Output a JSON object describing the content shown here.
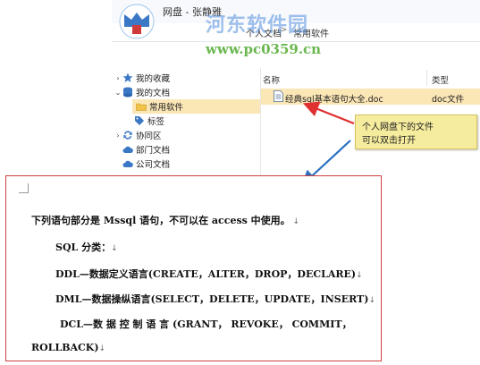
{
  "window": {
    "title": "网盘 - 张静雅",
    "address": {
      "part1": "个人文档",
      "separator": ">",
      "part2": "常用软件"
    }
  },
  "watermark": {
    "site_name": "河东软件园",
    "url": "www.pc0359.cn"
  },
  "nav": {
    "items": [
      {
        "label": "我的收藏",
        "icon": "star-icon",
        "expanded": false
      },
      {
        "label": "我的文档",
        "icon": "database-icon",
        "expanded": true
      },
      {
        "label": "常用软件",
        "icon": "folder-icon",
        "selected": true
      },
      {
        "label": "标签",
        "icon": "tag-icon"
      },
      {
        "label": "协同区",
        "icon": "sync-icon",
        "expanded": false
      },
      {
        "label": "部门文档",
        "icon": "cloud-icon"
      },
      {
        "label": "公司文档",
        "icon": "cloud-icon"
      }
    ]
  },
  "file_list": {
    "columns": {
      "name": "名称",
      "type": "类型"
    },
    "rows": [
      {
        "name": "经典sql基本语句大全.doc",
        "type": "doc文件",
        "icon": "document-icon"
      }
    ]
  },
  "callout": {
    "line1": "个人网盘下的文件",
    "line2": "可以双击打开"
  },
  "document": {
    "lines": [
      "下列语句部分是 Mssql 语句，不可以在 access 中使用。",
      "SQL 分类：",
      "DDL—数据定义语言(CREATE，ALTER，DROP，DECLARE)",
      "DML—数据操纵语言(SELECT，DELETE，UPDATE，INSERT)",
      "DCL—数 据 控 制 语 言 (GRANT， REVOKE， COMMIT，",
      "ROLLBACK)"
    ],
    "paragraph_mark": "↓"
  },
  "colors": {
    "highlight": "#fbe6b6",
    "frame": "#d04040",
    "callout_bg": "#f6ec9e",
    "arrow_red": "#e03030",
    "arrow_blue": "#2a6fc0"
  }
}
